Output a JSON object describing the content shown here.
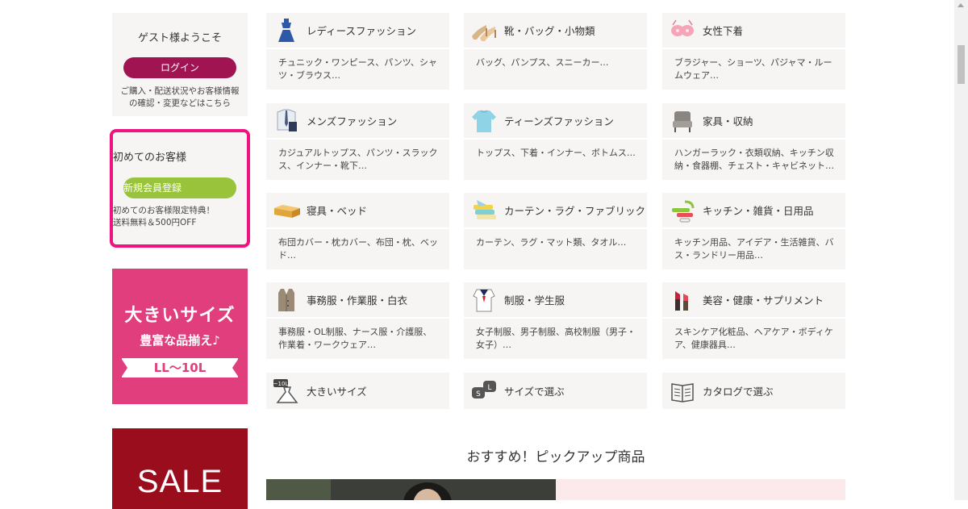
{
  "sidebar": {
    "welcome_title": "ゲスト様ようこそ",
    "login_button": "ログイン",
    "login_note_1": "ご購入・配送状況やお客様情報",
    "login_note_2": "の確認・変更などはこちら",
    "first_title": "初めてのお客様",
    "register_button": "新規会員登録",
    "first_note_1": "初めてのお客様限定特典！",
    "first_note_2": "送料無料＆500円OFF",
    "big_size_banner": {
      "line1": "大きいサイズ",
      "line2": "豊富な品揃え♪",
      "ribbon": "LL～10L"
    },
    "sale_banner": "SALE"
  },
  "categories": [
    {
      "name": "レディースファッション",
      "sub": "チュニック・ワンピース、パンツ、シャツ・ブラウス…",
      "icon": "dress-icon"
    },
    {
      "name": "靴・バッグ・小物類",
      "sub": "バッグ、パンプス、スニーカー…",
      "icon": "shoes-icon"
    },
    {
      "name": "女性下着",
      "sub": "ブラジャー、ショーツ、パジャマ・ルームウェア…",
      "icon": "lingerie-icon"
    },
    {
      "name": "メンズファッション",
      "sub": "カジュアルトップス、パンツ・スラックス、インナー・靴下…",
      "icon": "shirt-tie-icon"
    },
    {
      "name": "ティーンズファッション",
      "sub": "トップス、下着・インナー、ボトムス…",
      "icon": "sweater-icon"
    },
    {
      "name": "家具・収納",
      "sub": "ハンガーラック・衣類収納、キッチン収納・食器棚、チェスト・キャビネット…",
      "icon": "chair-icon"
    },
    {
      "name": "寝具・ベッド",
      "sub": "布団カバー・枕カバー、布団・枕、ベッド…",
      "icon": "mattress-icon"
    },
    {
      "name": "カーテン・ラグ・ファブリック",
      "sub": "カーテン、ラグ・マット類、タオル…",
      "icon": "fabric-icon"
    },
    {
      "name": "キッチン・雑貨・日用品",
      "sub": "キッチン用品、アイデア・生活雑貨、バス・ランドリー用品…",
      "icon": "kitchen-tools-icon"
    },
    {
      "name": "事務服・作業服・白衣",
      "sub": "事務服・OL制服、ナース服・介護服、作業着・ワークウェア…",
      "icon": "vest-icon"
    },
    {
      "name": "制服・学生服",
      "sub": "女子制服、男子制服、高校制服（男子・女子）…",
      "icon": "sailor-uniform-icon"
    },
    {
      "name": "美容・健康・サプリメント",
      "sub": "スキンケア化粧品、ヘアケア・ボディケア、健康器具…",
      "icon": "lipstick-icon"
    },
    {
      "name": "大きいサイズ",
      "sub": "",
      "icon": "big-size-dress-icon",
      "icon_badge": "~10L"
    },
    {
      "name": "サイズで選ぶ",
      "sub": "",
      "icon": "size-bubbles-icon",
      "bubble_s": "S",
      "bubble_l": "L"
    },
    {
      "name": "カタログで選ぶ",
      "sub": "",
      "icon": "catalog-book-icon"
    }
  ],
  "pickup": {
    "title": "おすすめ！ピックアップ商品"
  },
  "colors": {
    "login": "#a11452",
    "register": "#99c33b",
    "highlight_border": "#f0127f",
    "big_size_banner": "#e03e7d",
    "sale_banner": "#990d1c",
    "card_bg": "#f6f5f3"
  }
}
